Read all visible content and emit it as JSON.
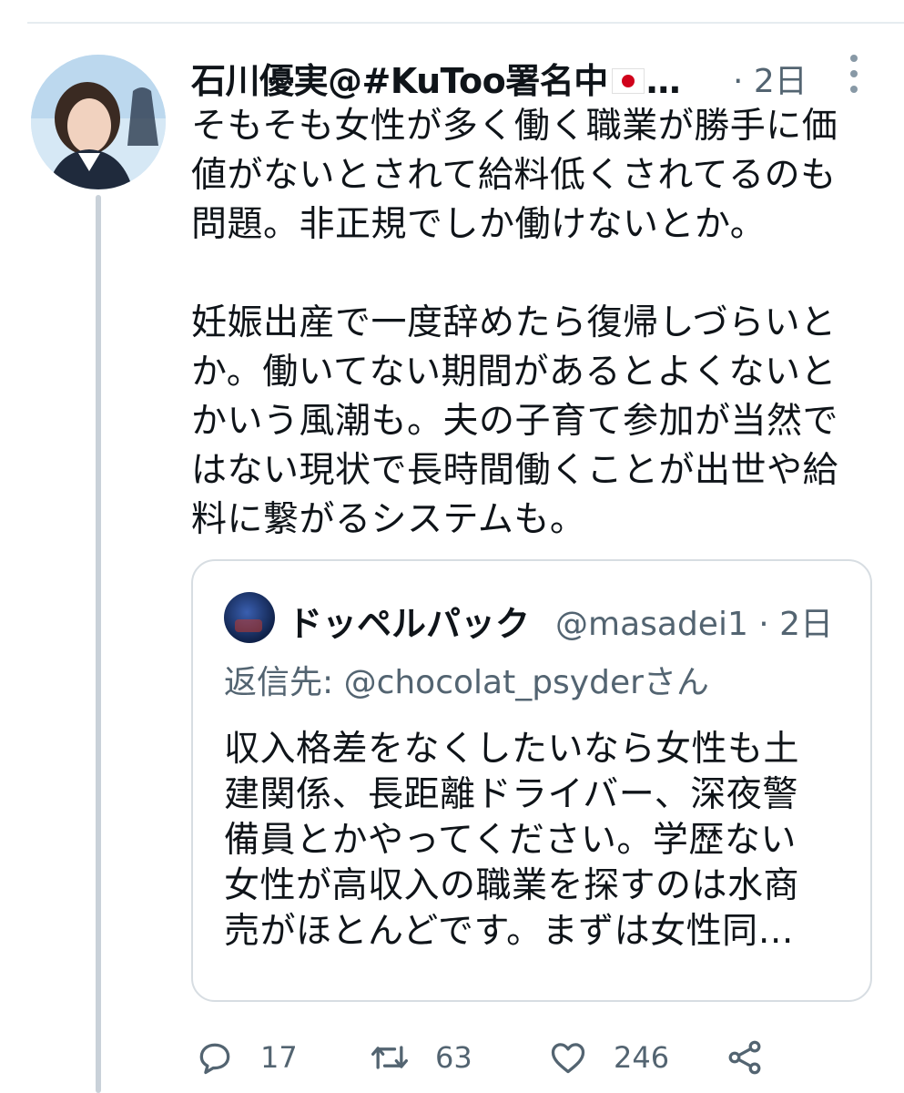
{
  "tweet": {
    "author_name": "石川優実@#KuToo署名中",
    "flag_icon": "japan-flag-icon",
    "ellipsis": "…",
    "time": "· 2日",
    "text": "そもそも女性が多く働く職業が勝手に価\n値がないとされて給料低くされてるのも\n問題。非正規でしか働けないとか。\n\n妊娠出産で一度辞めたら復帰しづらいと\nか。働いてない期間があるとよくないと\nかいう風潮も。夫の子育て参加が当然で\nはない現状で長時間働くことが出世や給\n料に繋がるシステムも。"
  },
  "quote": {
    "name": "ドッペルパック",
    "handle_time": "@masadei1 · 2日",
    "reply_to": "返信先: @chocolat_psyderさん",
    "text": "収入格差をなくしたいなら女性も土\n建関係、長距離ドライバー、深夜警\n備員とかやってください。学歴ない\n女性が高収入の職業を探すのは水商\n売がほとんどです。まずは女性同…"
  },
  "actions": {
    "replies": "17",
    "retweets": "63",
    "likes": "246"
  },
  "colors": {
    "text": "#0f1419",
    "secondary": "#536471",
    "border": "#d7dde2",
    "thread_line": "#c9d1d9"
  }
}
